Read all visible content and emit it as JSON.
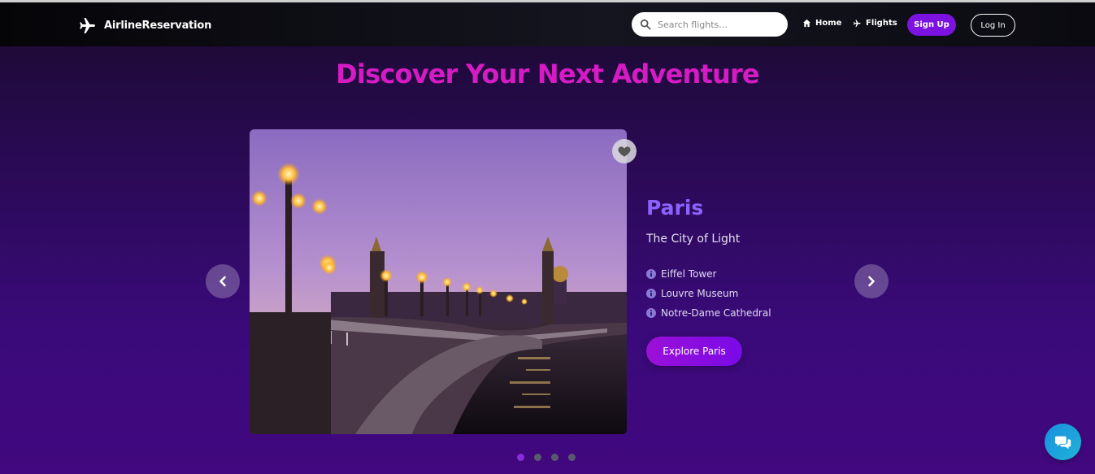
{
  "navbar": {
    "brand": "AirlineReservation",
    "search_placeholder": "Search flights...",
    "links": [
      {
        "label": "Home",
        "icon": "home-icon"
      },
      {
        "label": "Flights",
        "icon": "plane-icon"
      }
    ],
    "signup_label": "Sign Up",
    "login_label": "Log In"
  },
  "hero": {
    "title": "Discover Your Next Adventure"
  },
  "destination": {
    "city": "Paris",
    "tagline": "The City of Light",
    "attractions": [
      "Eiffel Tower",
      "Louvre Museum",
      "Notre-Dame Cathedral"
    ],
    "cta_label": "Explore Paris"
  },
  "carousel": {
    "slide_count": 4,
    "active_index": 0
  },
  "colors": {
    "accent_purple": "#7b12e0",
    "title_magenta": "#d51bc4",
    "city_violet": "#8a63ff",
    "chat_blue": "#1a8fe0"
  }
}
